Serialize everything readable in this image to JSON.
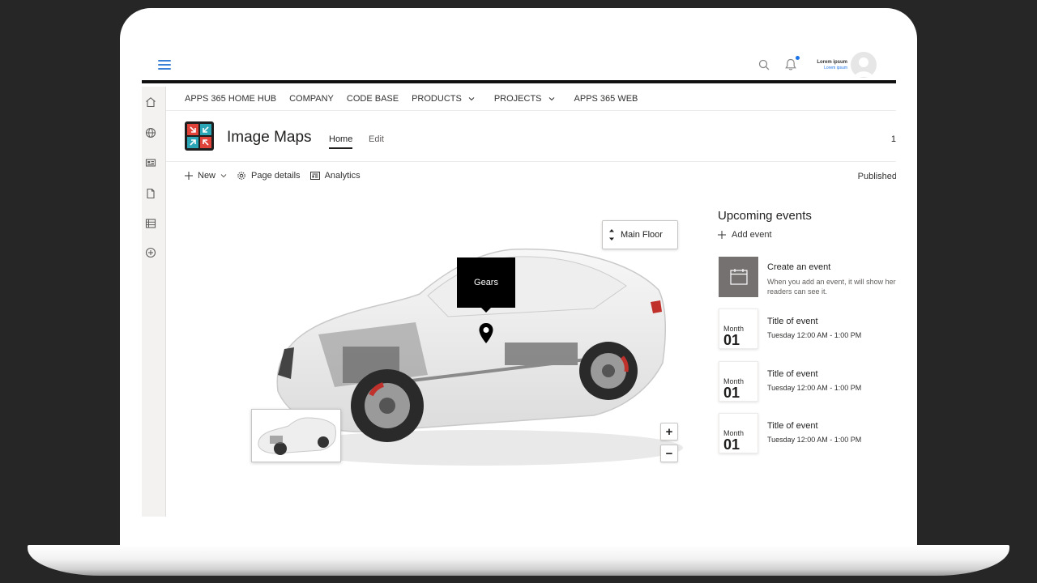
{
  "topbar": {
    "user_name": "Lorem ipsum",
    "user_sub": "Lorem ipsum"
  },
  "nav": {
    "items": [
      {
        "label": "APPS 365 HOME HUB",
        "dropdown": false
      },
      {
        "label": "COMPANY",
        "dropdown": false
      },
      {
        "label": "CODE BASE",
        "dropdown": false
      },
      {
        "label": "PRODUCTS",
        "dropdown": true
      },
      {
        "label": "PROJECTS",
        "dropdown": true
      },
      {
        "label": "APPS 365 WEB",
        "dropdown": false
      }
    ]
  },
  "site": {
    "title": "Image Maps",
    "tabs": [
      {
        "label": "Home",
        "active": true
      },
      {
        "label": "Edit",
        "active": false
      }
    ],
    "header_right": "1"
  },
  "commandbar": {
    "new_label": "New",
    "page_details_label": "Page details",
    "analytics_label": "Analytics",
    "published_label": "Published"
  },
  "imagemap": {
    "floor_label": "Main Floor",
    "hotspot_label": "Gears",
    "zoom_in": "+",
    "zoom_out": "−"
  },
  "events": {
    "title": "Upcoming events",
    "add_label": "Add event",
    "create": {
      "title": "Create an event",
      "desc_line1": "When you add an event, it will show her",
      "desc_line2": "readers can see it."
    },
    "items": [
      {
        "month": "Month",
        "day": "01",
        "title": "Title of event",
        "time": "Tuesday 12:00 AM - 1:00 PM"
      },
      {
        "month": "Month",
        "day": "01",
        "title": "Title of event",
        "time": "Tuesday 12:00 AM - 1:00 PM"
      },
      {
        "month": "Month",
        "day": "01",
        "title": "Title of event",
        "time": "Tuesday 12:00 AM - 1:00 PM"
      }
    ]
  },
  "colors": {
    "accent": "#3b82d6",
    "bell_dot": "#1a73e8",
    "tile_gray": "#767171",
    "logo_red": "#e0433a",
    "logo_teal": "#2aa6b7"
  }
}
